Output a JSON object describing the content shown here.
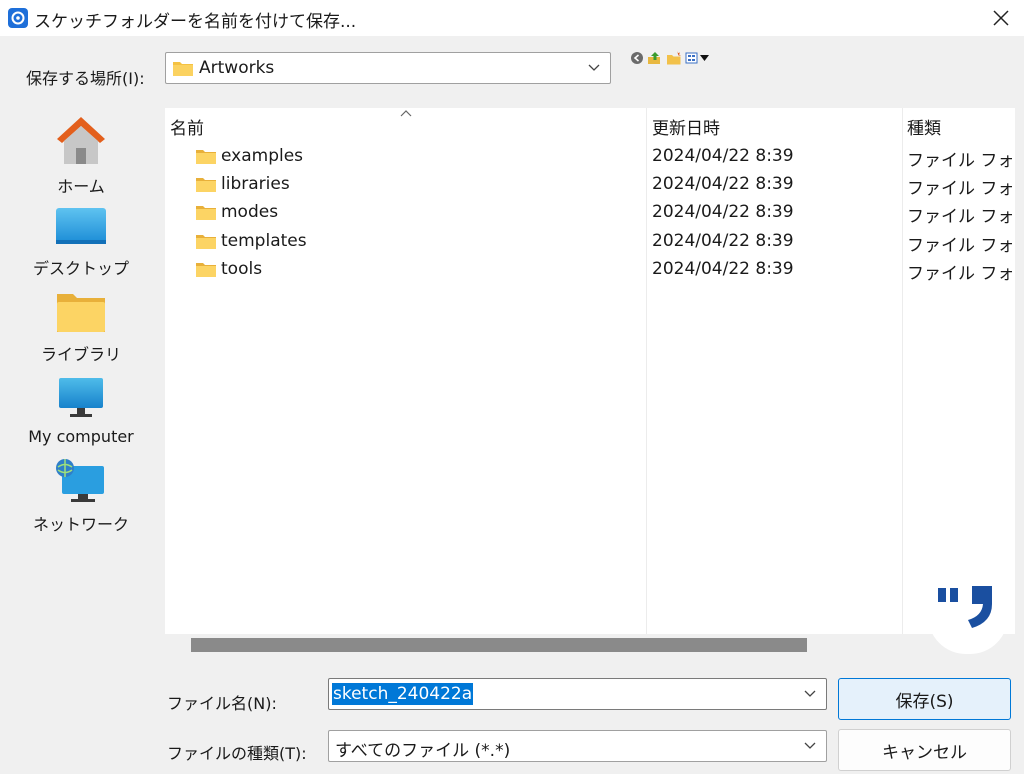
{
  "window": {
    "title": "スケッチフォルダーを名前を付けて保存..."
  },
  "lookin": {
    "label": "保存する場所(I):",
    "value": "Artworks"
  },
  "toolbar": {
    "icons": [
      "back-icon",
      "up-folder-icon",
      "new-folder-icon",
      "view-menu-icon"
    ]
  },
  "places": [
    {
      "label": "ホーム",
      "icon": "home-icon"
    },
    {
      "label": "デスクトップ",
      "icon": "desktop-icon"
    },
    {
      "label": "ライブラリ",
      "icon": "library-folder-icon"
    },
    {
      "label": "My computer",
      "icon": "computer-icon"
    },
    {
      "label": "ネットワーク",
      "icon": "network-icon"
    }
  ],
  "files": {
    "columns": [
      "名前",
      "更新日時",
      "種類"
    ],
    "rows": [
      {
        "name": "examples",
        "date": "2024/04/22 8:39",
        "type": "ファイル フォルダ"
      },
      {
        "name": "libraries",
        "date": "2024/04/22 8:39",
        "type": "ファイル フォルダ"
      },
      {
        "name": "modes",
        "date": "2024/04/22 8:39",
        "type": "ファイル フォルダ"
      },
      {
        "name": "templates",
        "date": "2024/04/22 8:39",
        "type": "ファイル フォルダ"
      },
      {
        "name": "tools",
        "date": "2024/04/22 8:39",
        "type": "ファイル フォルダ"
      }
    ]
  },
  "filename": {
    "label": "ファイル名(N):",
    "value": "sketch_240422a"
  },
  "filetype": {
    "label": "ファイルの種類(T):",
    "value": "すべてのファイル (*.*)"
  },
  "buttons": {
    "save": "保存(S)",
    "cancel": "キャンセル"
  },
  "colors": {
    "accent": "#0078d7",
    "folder": "#f5c242",
    "watermark": "#1a4fa0"
  }
}
